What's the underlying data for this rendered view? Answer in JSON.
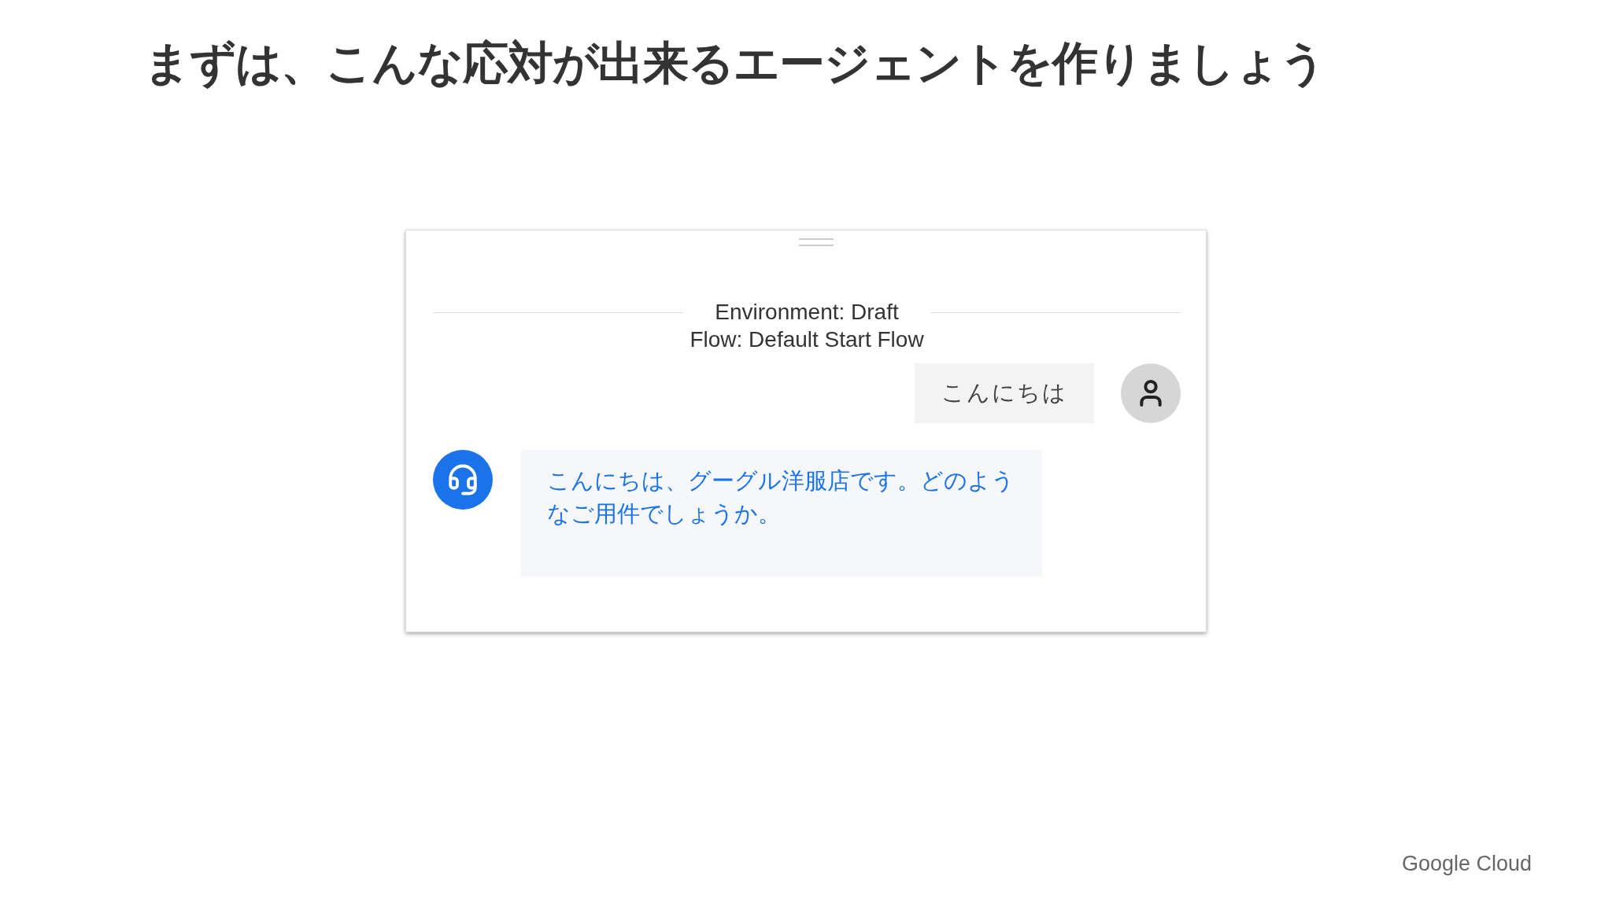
{
  "slide": {
    "title": "まずは、こんな応対が出来るエージェントを作りましょう"
  },
  "chat_panel": {
    "environment": "Environment: Draft",
    "flow": "Flow: Default Start Flow",
    "messages": [
      {
        "kind": "user",
        "text": "こんにちは"
      },
      {
        "kind": "agent",
        "text": "こんにちは、グーグル洋服店です。どのようなご用件でしょうか。"
      }
    ]
  },
  "footer": {
    "logo": "Google Cloud"
  }
}
